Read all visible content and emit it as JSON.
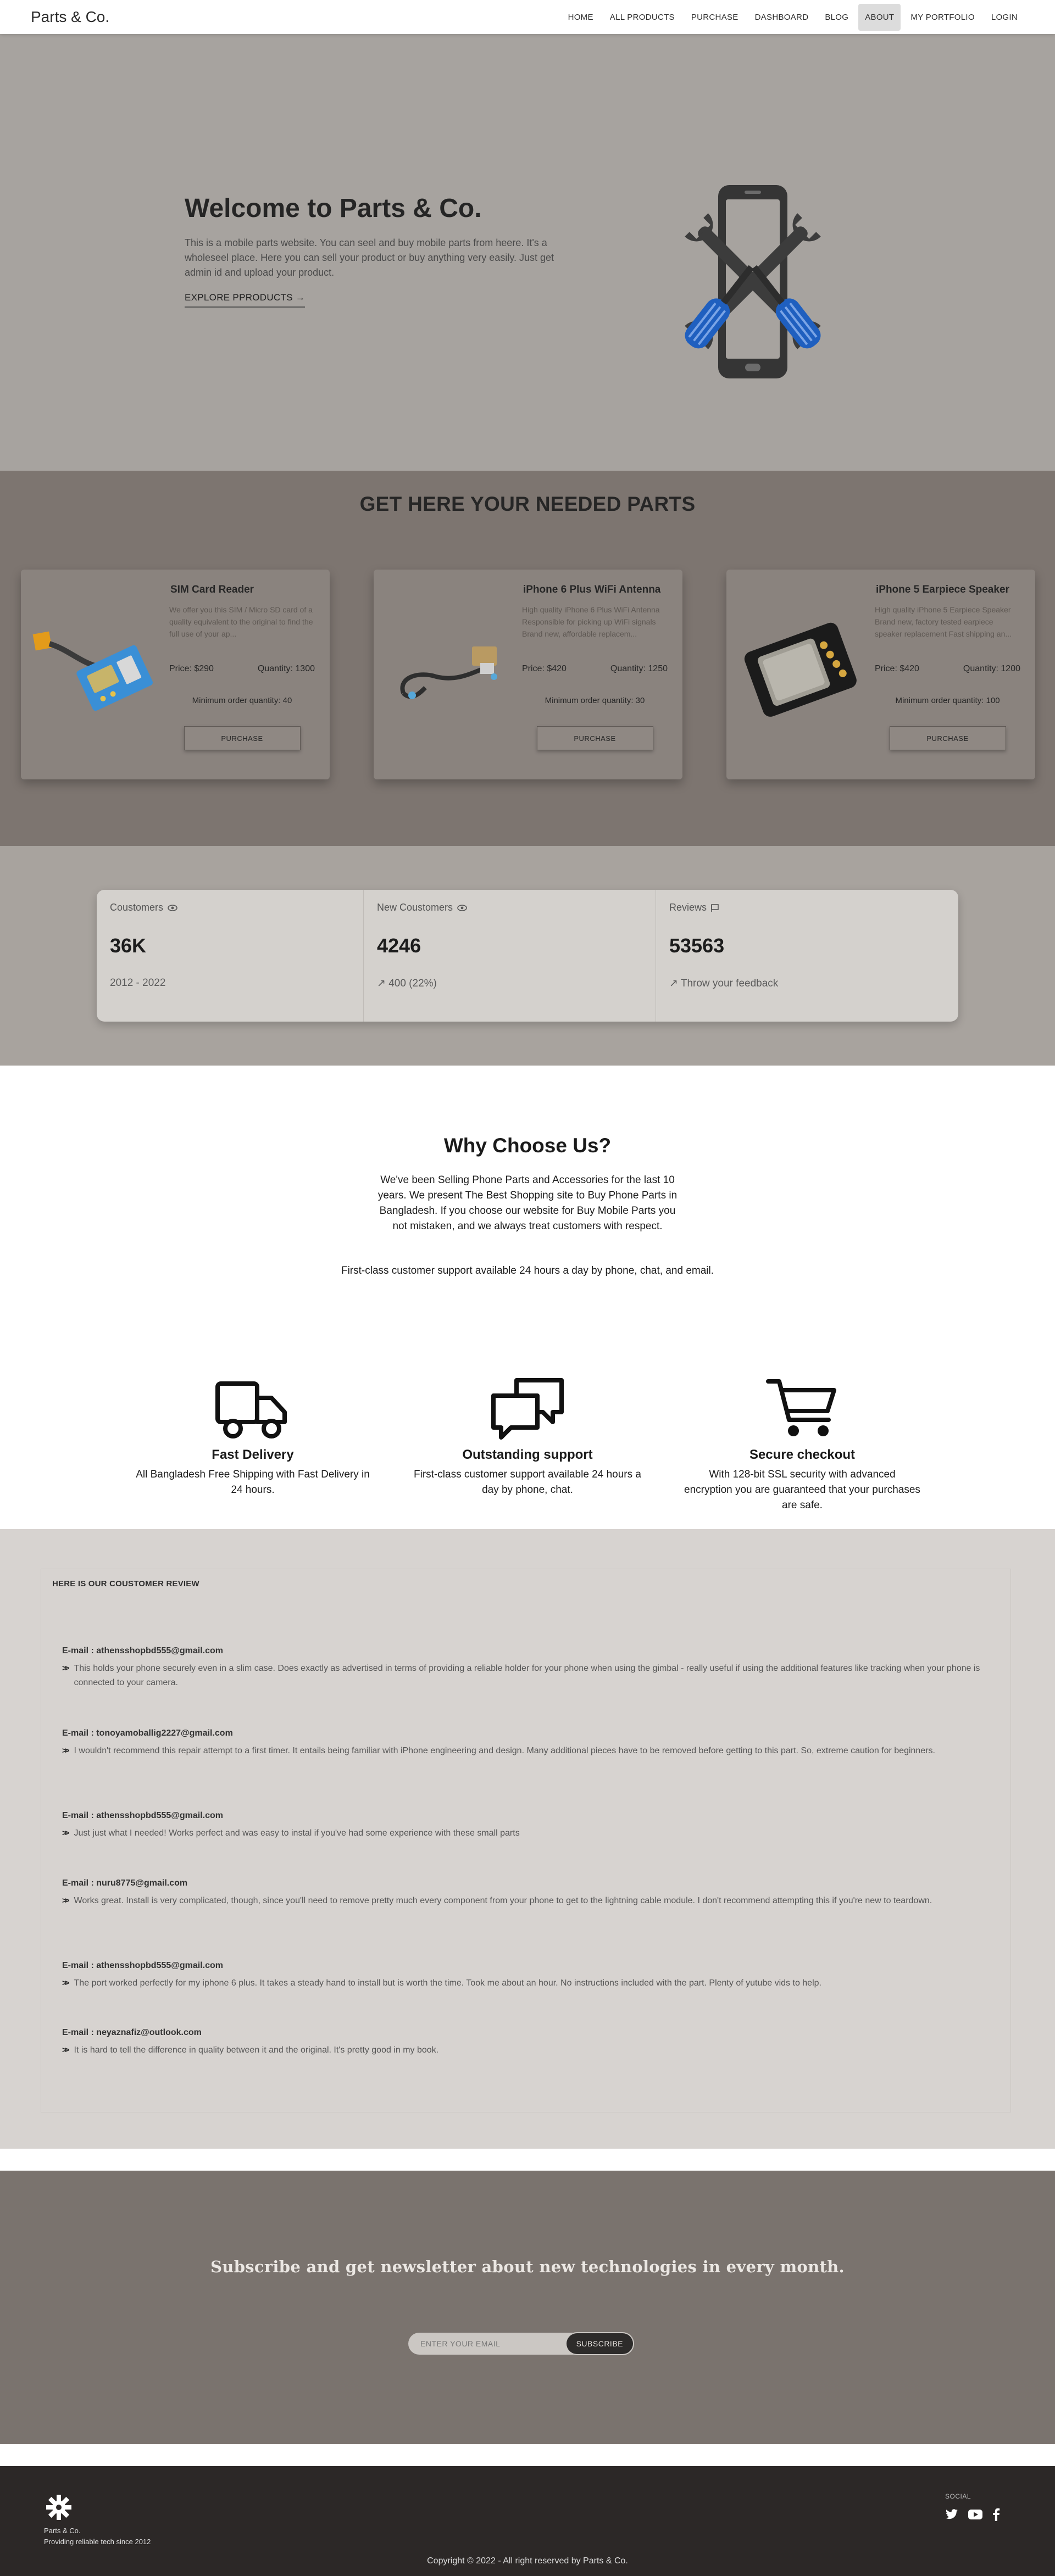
{
  "navbar": {
    "brand": "Parts & Co.",
    "links": [
      {
        "label": "HOME"
      },
      {
        "label": "ALL PRODUCTS"
      },
      {
        "label": "PURCHASE"
      },
      {
        "label": "DASHBOARD"
      },
      {
        "label": "BLOG"
      },
      {
        "label": "ABOUT",
        "active": true
      },
      {
        "label": "MY PORTFOLIO"
      },
      {
        "label": "LOGIN"
      }
    ]
  },
  "hero": {
    "title": "Welcome to Parts & Co.",
    "description": "This is a mobile parts website. You can seel and buy mobile parts from heere. It's a wholeseel place. Here you can sell your product or buy anything very easily. Just get admin id and upload your product.",
    "cta": "EXPLORE PPRODUCTS",
    "cta_arrow": "→"
  },
  "parts": {
    "title": "GET HERE YOUR NEEDED PARTS",
    "products": [
      {
        "name": "SIM Card Reader",
        "description": "We offer you this SIM / Micro SD card of a quality equivalent to the original to find the full use of your ap...",
        "price": "Price: $290",
        "quantity": "Quantity: 1300",
        "min_order": "Minimum order quantity: 40",
        "button": "PURCHASE",
        "icon": "sim-card-reader-icon"
      },
      {
        "name": "iPhone 6 Plus WiFi Antenna",
        "description": "High quality iPhone 6 Plus WiFi Antenna Responsible for picking up WiFi signals Brand new, affordable replacem...",
        "price": "Price: $420",
        "quantity": "Quantity: 1250",
        "min_order": "Minimum order quantity: 30",
        "button": "PURCHASE",
        "icon": "wifi-antenna-icon"
      },
      {
        "name": "iPhone 5 Earpiece Speaker",
        "description": "High quality iPhone 5 Earpiece Speaker Brand new, factory tested earpiece speaker replacement Fast shipping an...",
        "price": "Price: $420",
        "quantity": "Quantity: 1200",
        "min_order": "Minimum order quantity: 100",
        "button": "PURCHASE",
        "icon": "earpiece-speaker-icon"
      }
    ]
  },
  "stats": {
    "items": [
      {
        "title": "Coustomers",
        "icon": "eye-icon",
        "value": "36K",
        "desc": "2012 - 2022"
      },
      {
        "title": "New Coustomers",
        "icon": "eye-icon",
        "value": "4246",
        "desc": "↗ 400 (22%)"
      },
      {
        "title": "Reviews",
        "icon": "flag-icon",
        "value": "53563",
        "desc": "↗ Throw your feedback"
      }
    ]
  },
  "why": {
    "title": "Why Choose Us?",
    "description": "We've been Selling Phone Parts and Accessories for the last 10 years. We present The Best Shopping site to Buy Phone Parts in Bangladesh. If you choose our website for Buy Mobile Parts you not mistaken, and we always treat customers with respect.",
    "note": "First-class customer support available 24 hours a day by phone, chat, and email.",
    "features": [
      {
        "title": "Fast Delivery",
        "desc": "All Bangladesh Free Shipping with Fast Delivery in 24 hours.",
        "icon": "truck-icon"
      },
      {
        "title": "Outstanding support",
        "desc": "First-class customer support available 24 hours a day by phone, chat.",
        "icon": "chat-icon"
      },
      {
        "title": "Secure checkout",
        "desc": "With 128-bit SSL security with advanced encryption you are guaranteed that your purchases are safe.",
        "icon": "cart-icon"
      }
    ]
  },
  "reviews": {
    "title": "HERE IS OUR COUSTOMER REVIEW",
    "items": [
      {
        "email": "E-mail : athensshopbd555@gmail.com",
        "text": "This holds your phone securely even in a slim case. Does exactly as advertised in terms of providing a reliable holder for your phone when using the gimbal - really useful if using the additional features like tracking when your phone is connected to your camera."
      },
      {
        "email": "E-mail : tonoyamoballig2227@gmail.com",
        "text": "I wouldn't recommend this repair attempt to a first timer. It entails being familiar with iPhone engineering and design. Many additional pieces have to be removed before getting to this part. So, extreme caution for beginners."
      },
      {
        "email": "E-mail : athensshopbd555@gmail.com",
        "text": "Just just what I needed! Works perfect and was easy to instal if you've had some experience with these small parts"
      },
      {
        "email": "E-mail : nuru8775@gmail.com",
        "text": "Works great. Install is very complicated, though, since you'll need to remove pretty much every component from your phone to get to the lightning cable module. I don't recommend attempting this if you're new to teardown."
      },
      {
        "email": "E-mail : athensshopbd555@gmail.com",
        "text": "The port worked perfectly for my iphone 6 plus. It takes a steady hand to install but is worth the time. Took me about an hour. No instructions included with the part. Plenty of yutube vids to help."
      },
      {
        "email": "E-mail : neyaznafiz@outlook.com",
        "text": "It is hard to tell the difference in quality between it and the original. It's pretty good in my book."
      }
    ]
  },
  "subscribe": {
    "title": "Subscribe and get newsletter about new technologies in every month.",
    "placeholder": "ENTER YOUR EMAIL",
    "button": "SUBSCRIBE"
  },
  "footer": {
    "brand": "Parts & Co.",
    "tagline": "Providing reliable tech since 2012",
    "social_label": "SOCIAL",
    "social": [
      "twitter-icon",
      "youtube-icon",
      "facebook-icon"
    ],
    "copyright": "Copyright © 2022 - All right reserved by Parts & Co."
  },
  "colors": {
    "hero_bg": "#a7a39f",
    "parts_bg": "#7d7570",
    "stats_bg": "#a8a39e",
    "reviews_bg": "#d7d3d0",
    "subscribe_bg": "#7a736e",
    "footer_bg": "#2c2827",
    "screwdriver_blue": "#1f5fbf"
  }
}
